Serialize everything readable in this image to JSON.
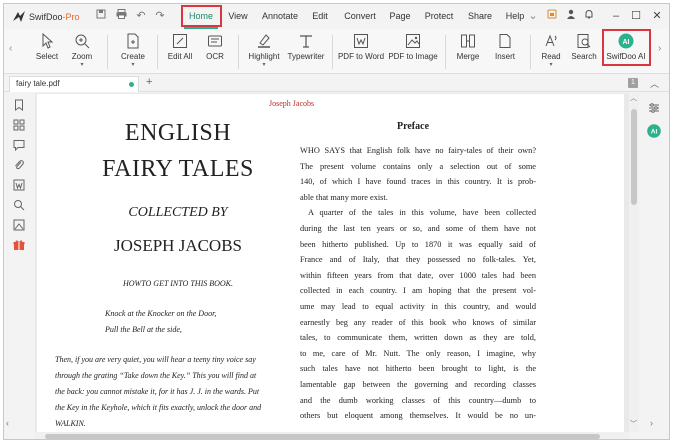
{
  "app": {
    "name": "SwifDoo",
    "edition": "-Pro"
  },
  "menus": [
    "Home",
    "View",
    "Annotate",
    "Edit",
    "Convert",
    "Page",
    "Protect",
    "Share",
    "Help"
  ],
  "ribbon": {
    "select": "Select",
    "zoom": "Zoom",
    "create": "Create",
    "edit_all": "Edit All",
    "ocr": "OCR",
    "highlight": "Highlight",
    "typewriter": "Typewriter",
    "pdf_to_word": "PDF to Word",
    "pdf_to_image": "PDF to Image",
    "merge": "Merge",
    "insert": "Insert",
    "read": "Read",
    "search": "Search",
    "swifdoo_ai": "SwifDoo AI",
    "ai_badge": "AI"
  },
  "tab": {
    "filename": "fairy tale.pdf",
    "page_count": "1"
  },
  "right_sidebar": {
    "ai_badge": "AI"
  },
  "document": {
    "header": "Joseph Jacobs",
    "title_line1": "ENGLISH",
    "title_line2": "FAIRY TALES",
    "collected_by": "COLLECTED BY",
    "author": "JOSEPH JACOBS",
    "howto": "HOWTO GET INTO THIS BOOK.",
    "knock1": "Knock at the Knocker on the Door,",
    "knock2": "Pull the Bell at the side,",
    "left_para": [
      "Then, if you are very quiet, you will hear a teeny tiny voice say",
      "through the grating “Take down the Key.” This you will find at",
      "the back: you cannot mistake it, for it has J. J. in the wards. Put",
      "the Key in the Keyhole, which it fits exactly, unlock the door and",
      "WALKIN."
    ],
    "preface_title": "Preface",
    "right_para": [
      "WHO SAYS that English folk have no fairy-tales of their own?",
      "The present volume contains only a selection out of some",
      "140, of which I have found traces in this country. It is prob-",
      "able that many more exist.",
      "A quarter of the tales in this volume, have been collected",
      "during the last ten years or so, and some of them have not",
      "been hitherto published. Up to 1870 it was equally said of",
      "France and of Italy, that they possessed no folk-tales. Yet,",
      "within fifteen years from that date, over 1000 tales had been",
      "collected in each country. I am hoping that the present vol-",
      "ume may lead to equal activity in this country, and would",
      "earnestly beg any reader of this book who knows of similar",
      "tales, to communicate them, written down as they are told,",
      "to me, care of Mr. Nutt. The only reason, I imagine, why",
      "such tales have not hitherto been brought to light, is the",
      "lamentable gap between the governing and recording classes",
      "and the dumb working classes of this country—dumb to",
      "others but eloquent among themselves. It would be no un-"
    ]
  },
  "colors": {
    "accent": "#2bb18b",
    "highlight_box": "#d9363e",
    "header_red": "#c02a2a"
  }
}
